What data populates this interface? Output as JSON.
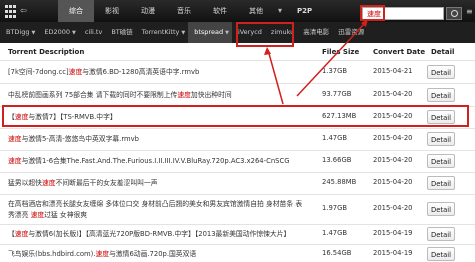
{
  "nav": {
    "back": "⇦",
    "items": [
      "综合",
      "影视",
      "动漫",
      "音乐",
      "软件",
      "其他"
    ],
    "p2p": "P2P",
    "search_value": "速度"
  },
  "sites": [
    {
      "label": "BTDigg"
    },
    {
      "label": "ED2000"
    },
    {
      "label": "cili.tv"
    },
    {
      "label": "BT磁链"
    },
    {
      "label": "TorrentKitty"
    },
    {
      "label": "btspread"
    },
    {
      "label": "iVerycd"
    },
    {
      "label": "zimuku"
    },
    {
      "label": "高清电影"
    },
    {
      "label": "迅雷资源"
    }
  ],
  "table": {
    "headers": {
      "desc": "Torrent Description",
      "size": "Files Size",
      "date": "Convert Date",
      "detail": "Detail"
    },
    "rows": [
      {
        "pre": "[7k空间-7dong.cc]",
        "hl": "速度",
        "post": "与激情6.BD-1280高清英语中字.rmvb",
        "size": "1.37GB",
        "date": "2015-04-21",
        "btn": "Detail"
      },
      {
        "pre": "中乱榜前图画系列 75部合集 请下载的同时不要限制上传",
        "hl": "速度",
        "post": "加快出种时间",
        "size": "93.77GB",
        "date": "2015-04-20",
        "btn": "Detail"
      },
      {
        "pre": "【",
        "hl": "速度",
        "post": "与激情7】【TS-RMVB.中字】",
        "size": "627.13MB",
        "date": "2015-04-20",
        "btn": "Detail"
      },
      {
        "pre": "",
        "hl": "速度",
        "post": "与激情5-高清-悠悠鸟中英双字幕.rmvb",
        "size": "1.47GB",
        "date": "2015-04-20",
        "btn": "Detail"
      },
      {
        "pre": "",
        "hl": "速度",
        "post": "与激情1-6合集The.Fast.And.The.Furious.I.II.III.IV.V.BluRay.720p.AC3.x264-CnSCG",
        "size": "13.66GB",
        "date": "2015-04-20",
        "btn": "Detail"
      },
      {
        "pre": "猛男以超快",
        "hl": "速度",
        "post": "不间断最后干的女友羞涩叫叫一声",
        "size": "245.88MB",
        "date": "2015-04-20",
        "btn": "Detail"
      },
      {
        "pre": "在高档酒店和漂亮长腿女友缠绵 多体位口交 身材前凸后翘的美女和男友宾馆激情自拍 身材苗条 表秀漂亮 ",
        "hl": "速度",
        "post": "过猛 女神很爽",
        "size": "1.97GB",
        "date": "2015-04-20",
        "btn": "Detail"
      },
      {
        "pre": "【",
        "hl": "速度",
        "post": "与激情6(加长版)】【高清蓝光720P版BD-RMVB.中字】【2013最新美国动作惊悚大片】",
        "size": "1.47GB",
        "date": "2015-04-19",
        "btn": "Detail"
      },
      {
        "pre": "飞鸟娱乐(bbs.hdbird.com).",
        "hl": "速度",
        "post": "与激情6动画.720p.国英双语",
        "size": "16.54GB",
        "date": "2015-04-19",
        "btn": "Detail"
      }
    ]
  },
  "colors": {
    "accent": "#d0211d",
    "highlight": "#cc0000",
    "topbar": "#111111"
  }
}
